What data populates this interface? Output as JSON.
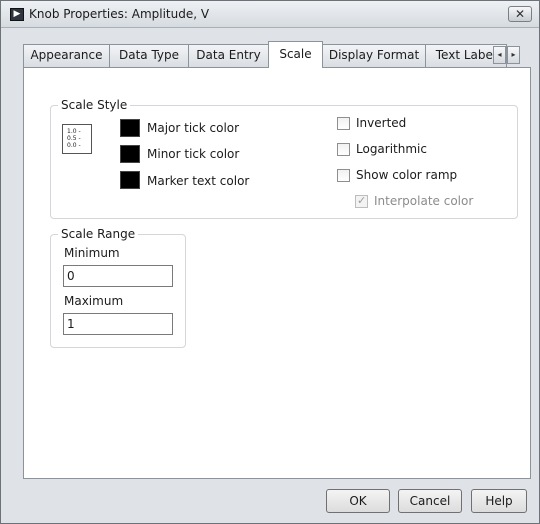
{
  "window": {
    "title": "Knob Properties: Amplitude, V",
    "app_icon_glyph": "▶",
    "close_glyph": "✕"
  },
  "tabs": [
    {
      "label": "Appearance"
    },
    {
      "label": "Data Type"
    },
    {
      "label": "Data Entry"
    },
    {
      "label": "Scale",
      "active": true
    },
    {
      "label": "Display Format"
    },
    {
      "label": "Text Label"
    }
  ],
  "tab_scroll": {
    "left": "◂",
    "right": "▸"
  },
  "scale_style": {
    "title": "Scale Style",
    "icon_lines": [
      "1.0 -",
      "0.5 -",
      "0.0 -"
    ],
    "major_tick_color_label": "Major tick color",
    "minor_tick_color_label": "Minor tick color",
    "marker_text_color_label": "Marker text color",
    "major_tick_color": "#000000",
    "minor_tick_color": "#000000",
    "marker_text_color": "#000000",
    "inverted_label": "Inverted",
    "inverted_checked": false,
    "logarithmic_label": "Logarithmic",
    "logarithmic_checked": false,
    "show_color_ramp_label": "Show color ramp",
    "show_color_ramp_checked": false,
    "interpolate_color_label": "Interpolate color",
    "interpolate_color_checked": true,
    "interpolate_color_enabled": false
  },
  "scale_range": {
    "title": "Scale Range",
    "minimum_label": "Minimum",
    "minimum_value": "0",
    "maximum_label": "Maximum",
    "maximum_value": "1"
  },
  "buttons": {
    "ok": "OK",
    "cancel": "Cancel",
    "help": "Help"
  }
}
